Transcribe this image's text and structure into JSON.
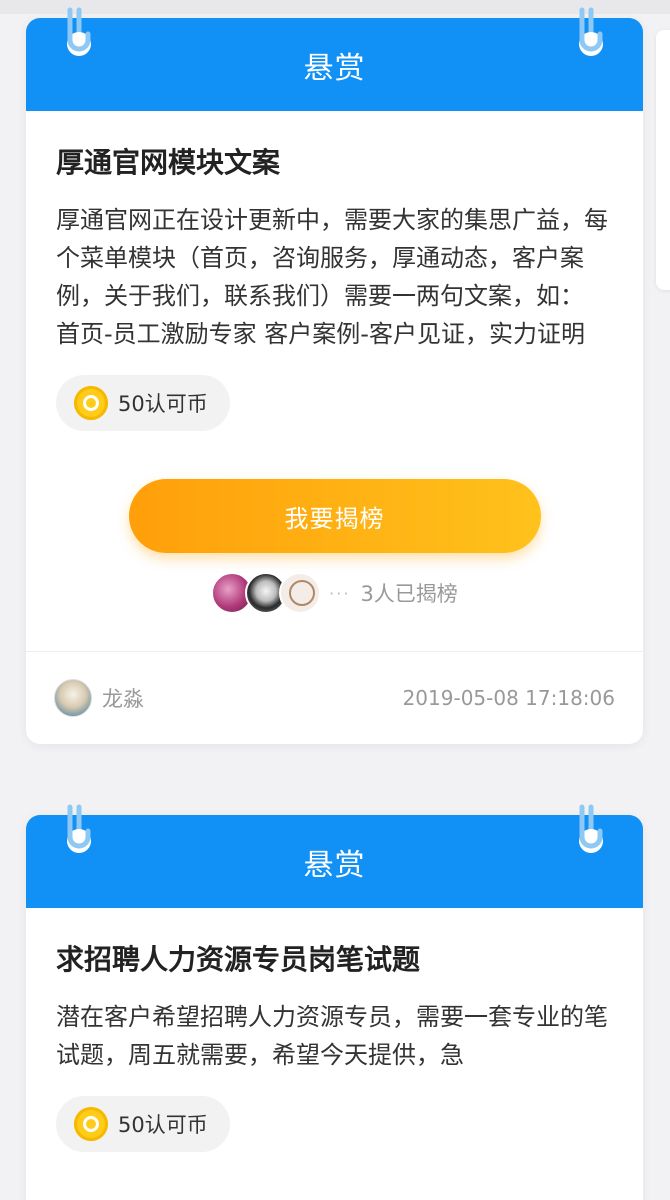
{
  "cards": [
    {
      "header": "悬赏",
      "title": "厚通官网模块文案",
      "description": "厚通官网正在设计更新中，需要大家的集思广益，每个菜单模块（首页，咨询服务，厚通动态，客户案例，关于我们，联系我们）需要一两句文案，如： 首页-员工激励专家 客户案例-客户见证，实力证明",
      "reward": "50认可币",
      "button_label": "我要揭榜",
      "takers_text": "3人已揭榜",
      "poster_name": "龙淼",
      "timestamp": "2019-05-08 17:18:06"
    },
    {
      "header": "悬赏",
      "title": "求招聘人力资源专员岗笔试题",
      "description": "潜在客户希望招聘人力资源专员，需要一套专业的笔试题，周五就需要，希望今天提供，急",
      "reward": "50认可币"
    }
  ],
  "icons": {
    "binder_ring": "ring-icon",
    "coin": "coin-icon",
    "more_dots": "···"
  },
  "colors": {
    "header_blue": "#1190f6",
    "button_orange_start": "#ff9f0a",
    "button_orange_end": "#ffc21c",
    "coin_yellow": "#ffcc1a"
  }
}
